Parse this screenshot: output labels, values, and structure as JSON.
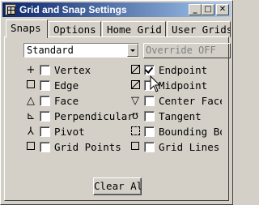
{
  "window": {
    "title": "Grid and Snap Settings",
    "buttons": {
      "minimize": "_",
      "maximize": "□",
      "close": "✕"
    }
  },
  "tabs": [
    {
      "label": "Snaps",
      "active": true
    },
    {
      "label": "Options",
      "active": false
    },
    {
      "label": "Home Grid",
      "active": false
    },
    {
      "label": "User Grids",
      "active": false
    }
  ],
  "snap_set": {
    "selected": "Standard"
  },
  "override_label": "Override OFF",
  "snaps_left": [
    {
      "label": "Vertex",
      "icon": "plus-icon",
      "checked": false
    },
    {
      "label": "Edge",
      "icon": "square-icon",
      "checked": false
    },
    {
      "label": "Face",
      "icon": "triangle-icon",
      "checked": false
    },
    {
      "label": "Perpendicular",
      "icon": "perpendicular-icon",
      "checked": false
    },
    {
      "label": "Pivot",
      "icon": "pivot-icon",
      "checked": false
    },
    {
      "label": "Grid Points",
      "icon": "square-icon",
      "checked": false
    }
  ],
  "snaps_right": [
    {
      "label": "Endpoint",
      "icon": "endpoint-icon",
      "checked": true
    },
    {
      "label": "Midpoint",
      "icon": "midpoint-icon",
      "checked": false
    },
    {
      "label": "Center Face",
      "icon": "center-face-icon",
      "checked": false
    },
    {
      "label": "Tangent",
      "icon": "tangent-icon",
      "checked": false
    },
    {
      "label": "Bounding Box",
      "icon": "bounding-box-icon",
      "checked": false
    },
    {
      "label": "Grid Lines",
      "icon": "square-icon",
      "checked": false
    }
  ],
  "clear_all": "Clear All"
}
